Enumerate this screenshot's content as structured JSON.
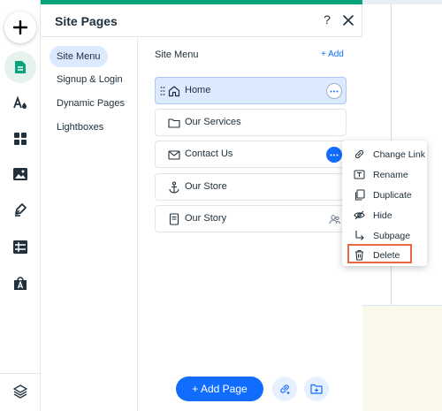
{
  "panel": {
    "title": "Site Pages",
    "help_label": "?"
  },
  "nav": {
    "items": [
      {
        "label": "Site Menu",
        "active": true
      },
      {
        "label": "Signup & Login"
      },
      {
        "label": "Dynamic Pages"
      },
      {
        "label": "Lightboxes"
      }
    ]
  },
  "list": {
    "title": "Site Menu",
    "add_label": "+ Add",
    "pages": [
      {
        "label": "Home",
        "icon": "home-icon",
        "selected": true
      },
      {
        "label": "Our Services",
        "icon": "folder-icon"
      },
      {
        "label": "Contact Us",
        "icon": "mail-icon"
      },
      {
        "label": "Our Store",
        "icon": "anchor-icon"
      },
      {
        "label": "Our Story",
        "icon": "page-icon"
      }
    ]
  },
  "context_menu": {
    "items": [
      {
        "label": "Change Link",
        "icon": "link-icon"
      },
      {
        "label": "Rename",
        "icon": "rename-icon"
      },
      {
        "label": "Duplicate",
        "icon": "duplicate-icon"
      },
      {
        "label": "Hide",
        "icon": "hide-icon"
      },
      {
        "label": "Subpage",
        "icon": "subpage-icon"
      },
      {
        "label": "Delete",
        "icon": "trash-icon",
        "highlighted": true
      }
    ]
  },
  "footer": {
    "add_page_label": "+ Add Page"
  },
  "toolbar": {
    "items": [
      "add-icon",
      "pages-icon",
      "theme-icon",
      "apps-icon",
      "media-icon",
      "pen-icon",
      "table-icon",
      "store-icon",
      "layers-icon"
    ]
  },
  "colors": {
    "accent": "#116dff",
    "brand_green": "#0aa37f",
    "highlight": "#e8683f",
    "selected_bg": "#dceaff"
  }
}
